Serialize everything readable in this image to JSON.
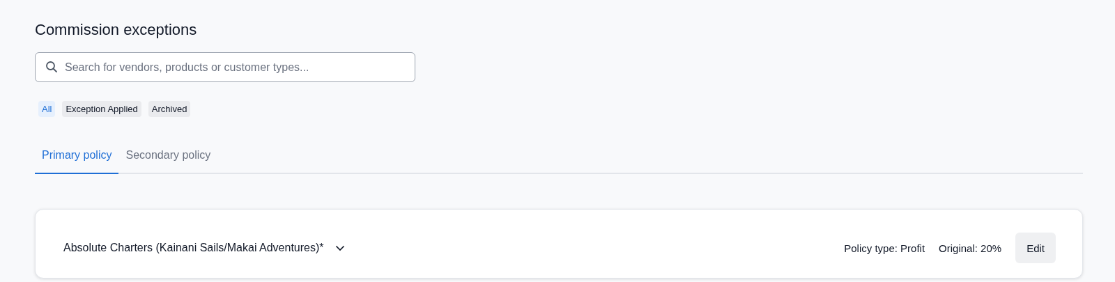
{
  "title": "Commission exceptions",
  "search": {
    "placeholder": "Search for vendors, products or customer types..."
  },
  "filters": [
    {
      "label": "All",
      "selected": true
    },
    {
      "label": "Exception Applied",
      "selected": false
    },
    {
      "label": "Archived",
      "selected": false
    }
  ],
  "tabs": [
    {
      "label": "Primary policy",
      "selected": true
    },
    {
      "label": "Secondary policy",
      "selected": false
    }
  ],
  "card": {
    "name": "Absolute Charters (Kainani Sails/Makai Adventures)*",
    "expanded": false,
    "policy_type": "Policy type: Profit",
    "original": "Original: 20%",
    "edit_button": "Edit"
  }
}
